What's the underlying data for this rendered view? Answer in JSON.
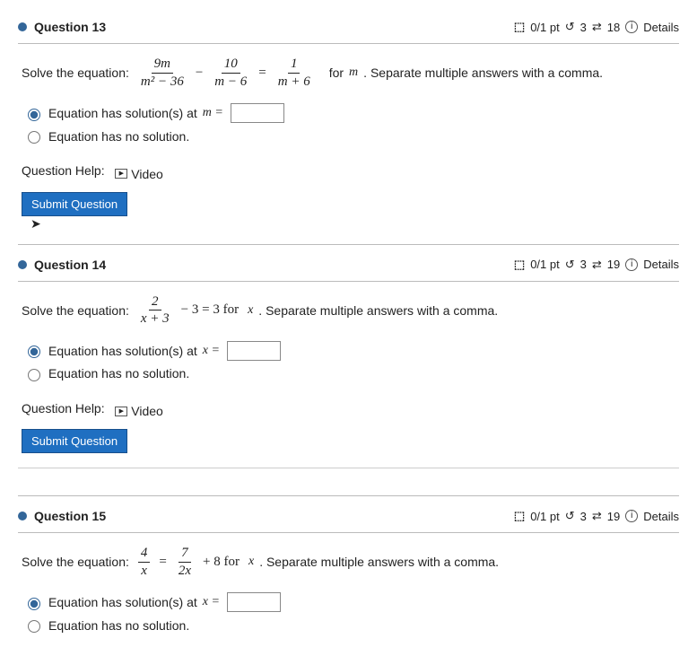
{
  "questions": [
    {
      "title": "Question 13",
      "score": "0/1 pt",
      "retries": "3",
      "attempts": "18",
      "details": "Details",
      "prompt_lead": "Solve the equation:",
      "prompt_tail": "for",
      "prompt_var": "m",
      "prompt_tail2": ". Separate multiple answers with a comma.",
      "frac1_num": "9m",
      "frac1_den": "m² − 36",
      "frac2_num": "10",
      "frac2_den": "m − 6",
      "frac3_num": "1",
      "frac3_den": "m + 6",
      "opt1": "Equation has solution(s) at",
      "opt1_var": "m =",
      "opt2": "Equation has no solution.",
      "help_label": "Question Help:",
      "video": "Video",
      "submit": "Submit Question"
    },
    {
      "title": "Question 14",
      "score": "0/1 pt",
      "retries": "3",
      "attempts": "19",
      "details": "Details",
      "prompt_lead": "Solve the equation:",
      "prompt_tail_full": " − 3 = 3 for ",
      "prompt_var": "x",
      "prompt_tail2": ". Separate multiple answers with a comma.",
      "frac1_num": "2",
      "frac1_den": "x + 3",
      "opt1": "Equation has solution(s) at",
      "opt1_var": "x =",
      "opt2": "Equation has no solution.",
      "help_label": "Question Help:",
      "video": "Video",
      "submit": "Submit Question"
    },
    {
      "title": "Question 15",
      "score": "0/1 pt",
      "retries": "3",
      "attempts": "19",
      "details": "Details",
      "prompt_lead": "Solve the equation:",
      "prompt_tail_full": " + 8   for ",
      "prompt_var": "x",
      "prompt_tail2": ". Separate multiple answers with a comma.",
      "frac1_num": "4",
      "frac1_den": "x",
      "frac2_num": "7",
      "frac2_den": "2x",
      "opt1": "Equation has solution(s) at",
      "opt1_var": "x =",
      "opt2": "Equation has no solution."
    }
  ],
  "icons": {
    "check": "⬚",
    "redo": "↺",
    "swap": "⇄",
    "info": "i",
    "play": "▶"
  }
}
